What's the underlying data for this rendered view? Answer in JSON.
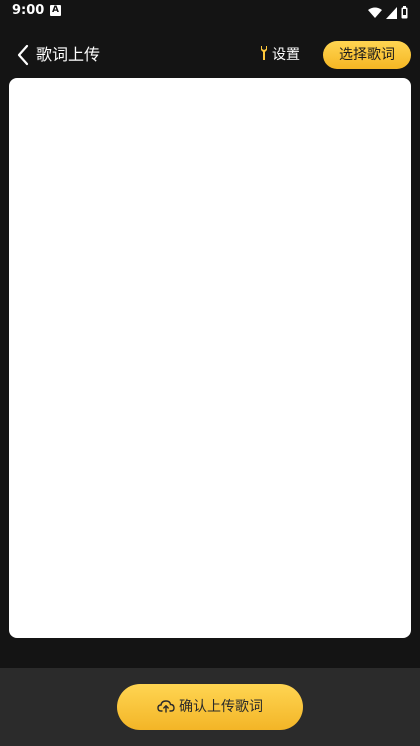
{
  "status_bar": {
    "time": "9:00",
    "notification_letter": "A"
  },
  "header": {
    "title": "歌词上传",
    "settings_label": "设置",
    "select_button_label": "选择歌词"
  },
  "lyrics_card": {
    "content": ""
  },
  "bottom": {
    "upload_button_label": "确认上传歌词"
  },
  "colors": {
    "background": "#141414",
    "accent": "#ffc93c",
    "card": "#ffffff",
    "bottom_bar": "#2b2b2b"
  }
}
